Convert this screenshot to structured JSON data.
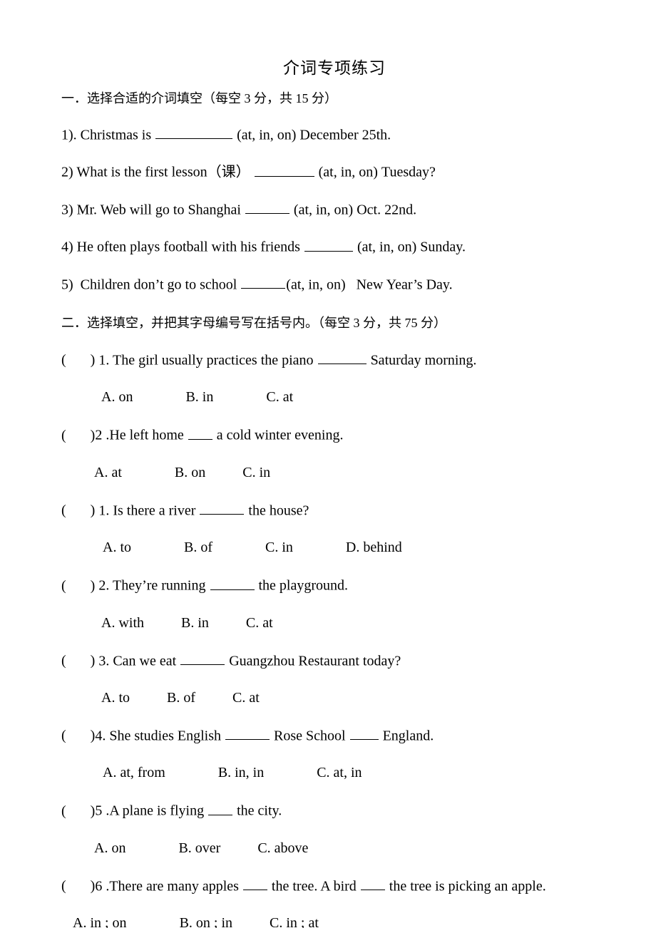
{
  "document": {
    "title": "介词专项练习"
  },
  "part_one": {
    "heading": "一．选择合适的介词填空（每空 3 分，共 15 分）",
    "questions": [
      {
        "number": "1).",
        "text_before": "Christmas is",
        "text_after": "(at, in, on) December 25th."
      },
      {
        "number": "2)",
        "text_before": "What is the first lesson（课）",
        "text_after": "(at, in, on) Tuesday?"
      },
      {
        "number": "3)",
        "text_before": "Mr. Web will go to Shanghai",
        "text_after": "(at, in, on) Oct. 22nd."
      },
      {
        "number": "4)",
        "text_before": "He often plays football with his friends",
        "text_after": "(at, in, on) Sunday."
      },
      {
        "number": "5)",
        "text_before": "Children don’t go to school",
        "text_after": "(at, in, on)   New Year’s Day."
      }
    ]
  },
  "part_two": {
    "heading": "二．选择填空，并把其字母编号写在括号内。（每空 3 分，共 75 分）",
    "questions": [
      {
        "paren_open": "(",
        "paren_close": ")",
        "number": "1.",
        "text_before": "The girl usually practices the piano",
        "text_after": "Saturday morning.",
        "options": [
          "A. on",
          "B. in",
          "C. at"
        ]
      },
      {
        "paren_open": "(",
        "paren_close": ")",
        "number": "2 .",
        "text_before": "He left home",
        "text_after": "a cold winter evening.",
        "options": [
          "A. at",
          "B. on",
          "C. in"
        ]
      },
      {
        "paren_open": "(",
        "paren_close": ")",
        "number": "1.",
        "text_before": "Is there a river",
        "text_after": "the house?",
        "options": [
          "A. to",
          "B. of",
          "C. in",
          "D. behind"
        ]
      },
      {
        "paren_open": "(",
        "paren_close": ")",
        "number": "2.",
        "text_before": "They’re running",
        "text_after": "the playground.",
        "options": [
          "A. with",
          "B. in",
          "C. at"
        ]
      },
      {
        "paren_open": "(",
        "paren_close": ")",
        "number": "3.",
        "text_before": "Can we eat",
        "text_after": "Guangzhou Restaurant today?",
        "options": [
          "A. to",
          "B. of",
          "C. at"
        ]
      },
      {
        "paren_open": "(",
        "paren_close": ")",
        "number": "4.",
        "text_before": "She studies English",
        "text_middle": "Rose School",
        "text_after": "England.",
        "options": [
          "A. at, from",
          "B. in, in",
          "C. at, in"
        ]
      },
      {
        "paren_open": "(",
        "paren_close": ")",
        "number": "5 .",
        "text_before": "A plane is flying",
        "text_after": "the city.",
        "options": [
          "A. on",
          "B. over",
          "C. above"
        ]
      },
      {
        "paren_open": "(",
        "paren_close": ")",
        "number": "6 .",
        "text_before": "There are many apples",
        "text_middle": "the tree. A bird",
        "text_after": "the tree is picking an apple.",
        "options": [
          "A. in ; on",
          "B. on ; in",
          "C. in ; at"
        ]
      }
    ]
  },
  "colors": {
    "text": "#000000",
    "background": "#ffffff"
  }
}
